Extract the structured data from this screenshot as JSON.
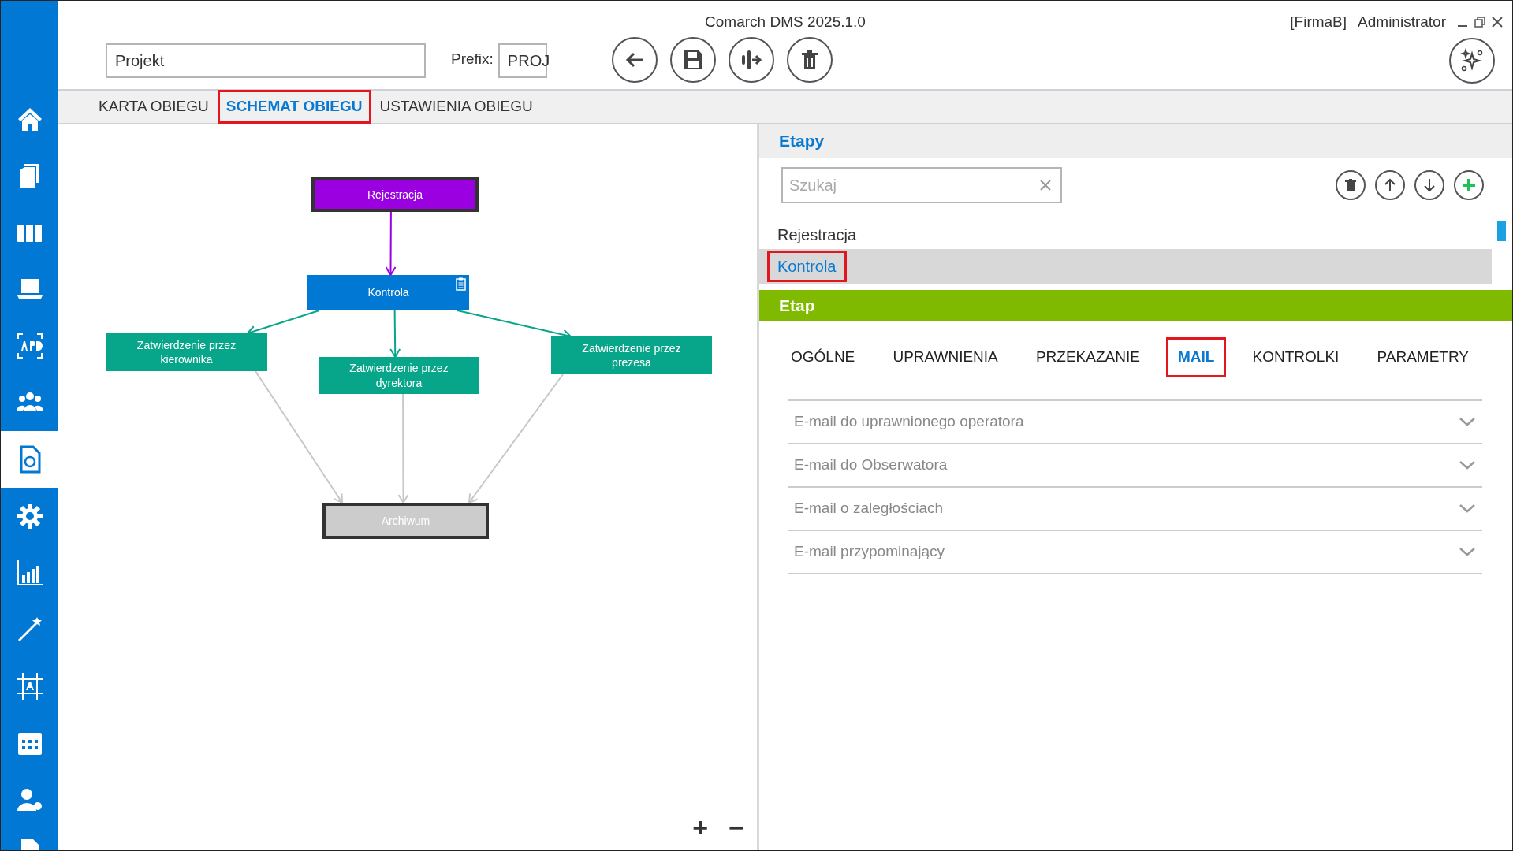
{
  "window": {
    "title": "Comarch DMS 2025.1.0",
    "company": "[FirmaB]",
    "user": "Administrator"
  },
  "sidebar": {
    "items": [
      {
        "selected": false
      },
      {
        "selected": false
      },
      {
        "selected": false
      },
      {
        "selected": false
      },
      {
        "selected": false
      },
      {
        "selected": false
      },
      {
        "selected": true
      },
      {
        "selected": false
      },
      {
        "selected": false
      },
      {
        "selected": false
      },
      {
        "selected": false
      },
      {
        "selected": false
      },
      {
        "selected": false
      },
      {
        "selected": false
      }
    ]
  },
  "header": {
    "name_value": "Projekt",
    "prefix_label": "Prefix:",
    "prefix_value": "PROJ"
  },
  "tabs": [
    {
      "label": "KARTA OBIEGU",
      "selected": false,
      "highlighted": false
    },
    {
      "label": "SCHEMAT OBIEGU",
      "selected": true,
      "highlighted": true
    },
    {
      "label": "USTAWIENIA OBIEGU",
      "selected": false,
      "highlighted": false
    }
  ],
  "diagram": {
    "nodes": [
      {
        "label": "Rejestracja",
        "kind": "terminal",
        "color": "#9b00e0",
        "note": false
      },
      {
        "label": "Kontrola",
        "kind": "step",
        "color": "#0078d4",
        "note": true
      },
      {
        "label": "Zatwierdzenie przez kierownika",
        "kind": "step",
        "color": "#07a68a",
        "note": false
      },
      {
        "label": "Zatwierdzenie przez dyrektora",
        "kind": "step",
        "color": "#07a68a",
        "note": false
      },
      {
        "label": "Zatwierdzenie przez prezesa",
        "kind": "step",
        "color": "#07a68a",
        "note": false
      },
      {
        "label": "Archiwum",
        "kind": "terminal",
        "color": "#cccccc",
        "note": false
      }
    ],
    "edges": [
      {
        "color": "#9b00e0"
      },
      {
        "color": "#07a68a"
      },
      {
        "color": "#07a68a"
      },
      {
        "color": "#07a68a"
      },
      {
        "color": "#c8c8c8"
      },
      {
        "color": "#c8c8c8"
      },
      {
        "color": "#c8c8c8"
      }
    ],
    "zoom_in": "+",
    "zoom_out": "−"
  },
  "stages": {
    "title": "Etapy",
    "search": {
      "placeholder": "Szukaj"
    },
    "items": [
      {
        "label": "Rejestracja",
        "selected": false,
        "highlighted": false
      },
      {
        "label": "Kontrola",
        "selected": true,
        "highlighted": true
      }
    ]
  },
  "stage": {
    "title": "Etap",
    "tabs": [
      {
        "label": "OGÓLNE",
        "selected": false,
        "highlighted": false
      },
      {
        "label": "UPRAWNIENIA",
        "selected": false,
        "highlighted": false
      },
      {
        "label": "PRZEKAZANIE",
        "selected": false,
        "highlighted": false
      },
      {
        "label": "MAIL",
        "selected": true,
        "highlighted": true
      },
      {
        "label": "KONTROLKI",
        "selected": false,
        "highlighted": false
      },
      {
        "label": "PARAMETRY",
        "selected": false,
        "highlighted": false
      }
    ],
    "sections": [
      {
        "label": "E-mail do uprawnionego operatora",
        "expanded": false
      },
      {
        "label": "E-mail do Obserwatora",
        "expanded": false
      },
      {
        "label": "E-mail o zaległościach",
        "expanded": false
      },
      {
        "label": "E-mail przypominający",
        "expanded": false
      }
    ]
  }
}
